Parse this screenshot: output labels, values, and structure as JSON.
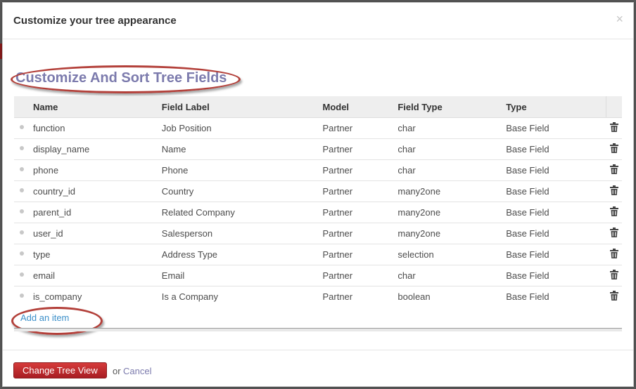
{
  "modal": {
    "title": "Customize your tree appearance",
    "close_glyph": "×"
  },
  "section": {
    "title": "Customize And Sort Tree Fields"
  },
  "table": {
    "headers": {
      "name": "Name",
      "field_label": "Field Label",
      "model": "Model",
      "field_type": "Field Type",
      "type": "Type"
    },
    "rows": [
      {
        "name": "function",
        "field_label": "Job Position",
        "model": "Partner",
        "field_type": "char",
        "type": "Base Field"
      },
      {
        "name": "display_name",
        "field_label": "Name",
        "model": "Partner",
        "field_type": "char",
        "type": "Base Field"
      },
      {
        "name": "phone",
        "field_label": "Phone",
        "model": "Partner",
        "field_type": "char",
        "type": "Base Field"
      },
      {
        "name": "country_id",
        "field_label": "Country",
        "model": "Partner",
        "field_type": "many2one",
        "type": "Base Field"
      },
      {
        "name": "parent_id",
        "field_label": "Related Company",
        "model": "Partner",
        "field_type": "many2one",
        "type": "Base Field"
      },
      {
        "name": "user_id",
        "field_label": "Salesperson",
        "model": "Partner",
        "field_type": "many2one",
        "type": "Base Field"
      },
      {
        "name": "type",
        "field_label": "Address Type",
        "model": "Partner",
        "field_type": "selection",
        "type": "Base Field"
      },
      {
        "name": "email",
        "field_label": "Email",
        "model": "Partner",
        "field_type": "char",
        "type": "Base Field"
      },
      {
        "name": "is_company",
        "field_label": "Is a Company",
        "model": "Partner",
        "field_type": "boolean",
        "type": "Base Field"
      }
    ],
    "add_item_label": "Add an item"
  },
  "footer": {
    "primary_label": "Change Tree View",
    "or_text": "or",
    "cancel_label": "Cancel"
  },
  "colors": {
    "accent": "#7c7bad",
    "primary": "#c0282d",
    "link": "#3b8fc9",
    "annotation": "#b3403a"
  }
}
